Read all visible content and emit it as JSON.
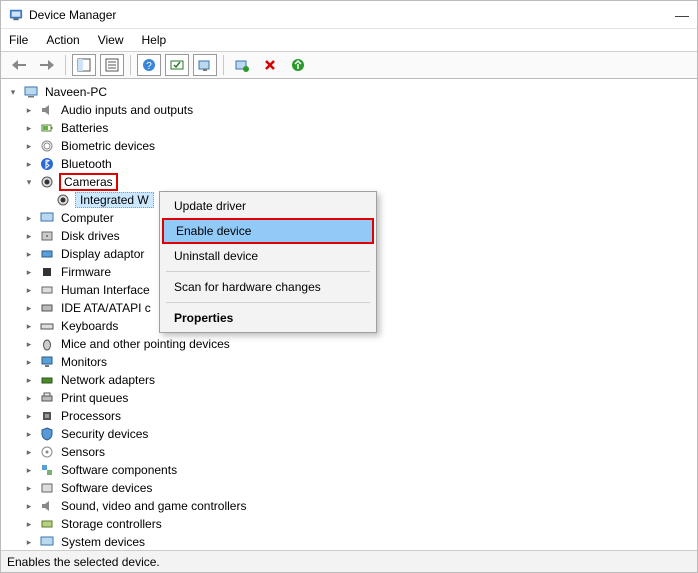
{
  "window": {
    "title": "Device Manager",
    "min": "—",
    "restore": "🗖",
    "close": "✕"
  },
  "menu": {
    "file": "File",
    "action": "Action",
    "view": "View",
    "help": "Help"
  },
  "tree": {
    "root": "Naveen-PC",
    "nodes": {
      "audio": "Audio inputs and outputs",
      "batteries": "Batteries",
      "biometric": "Biometric devices",
      "bluetooth": "Bluetooth",
      "cameras": "Cameras",
      "integrated": "Integrated W",
      "computer": "Computer",
      "disk": "Disk drives",
      "display": "Display adaptor",
      "firmware": "Firmware",
      "hid": "Human Interface",
      "ide": "IDE ATA/ATAPI c",
      "keyboards": "Keyboards",
      "mice": "Mice and other pointing devices",
      "monitors": "Monitors",
      "network": "Network adapters",
      "print": "Print queues",
      "processors": "Processors",
      "security": "Security devices",
      "sensors": "Sensors",
      "swcomp": "Software components",
      "swdev": "Software devices",
      "sound": "Sound, video and game controllers",
      "storage": "Storage controllers",
      "system": "System devices"
    }
  },
  "context_menu": {
    "update": "Update driver",
    "enable": "Enable device",
    "uninstall": "Uninstall device",
    "scan": "Scan for hardware changes",
    "properties": "Properties"
  },
  "status": "Enables the selected device."
}
